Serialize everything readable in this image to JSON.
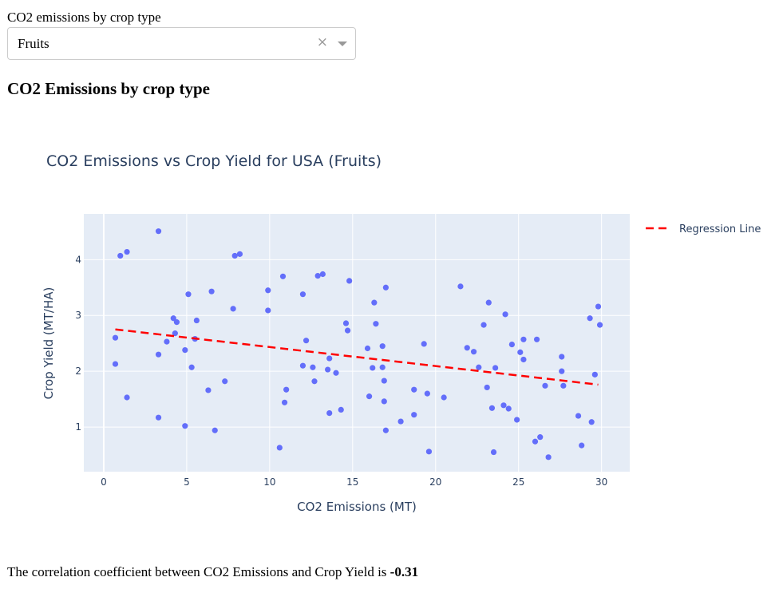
{
  "dropdown": {
    "label": "CO2 emissions by crop type",
    "selected": "Fruits",
    "clear_glyph": "×"
  },
  "heading": "CO2 Emissions by crop type",
  "correlation": {
    "text": "The correlation coefficient between CO2 Emissions and Crop Yield is ",
    "value": "-0.31"
  },
  "colors": {
    "marker": "#636efa",
    "regression": "#ff0000",
    "plot_bg": "#e5ecf6",
    "title": "#2a3f5f"
  },
  "chart_data": {
    "type": "scatter",
    "title": "CO2 Emissions vs Crop Yield for USA (Fruits)",
    "xlabel": "CO2 Emissions (MT)",
    "ylabel": "Crop Yield (MT/HA)",
    "xlim": [
      -1.2,
      31.7
    ],
    "ylim": [
      0.2,
      4.82
    ],
    "xticks": [
      0,
      5,
      10,
      15,
      20,
      25,
      30
    ],
    "yticks": [
      1,
      2,
      3,
      4
    ],
    "grid": true,
    "legend": {
      "position": "top-right",
      "entries": [
        "Regression Line"
      ]
    },
    "series": [
      {
        "name": "",
        "mode": "markers",
        "points": [
          [
            0.7,
            2.6
          ],
          [
            0.7,
            2.13
          ],
          [
            1.0,
            4.07
          ],
          [
            1.4,
            4.14
          ],
          [
            1.4,
            1.53
          ],
          [
            3.3,
            4.51
          ],
          [
            3.3,
            2.3
          ],
          [
            3.3,
            1.17
          ],
          [
            3.8,
            2.53
          ],
          [
            4.2,
            2.95
          ],
          [
            4.4,
            2.88
          ],
          [
            4.3,
            2.68
          ],
          [
            4.9,
            2.38
          ],
          [
            4.9,
            1.02
          ],
          [
            5.1,
            3.38
          ],
          [
            5.3,
            2.07
          ],
          [
            5.5,
            2.58
          ],
          [
            5.6,
            2.91
          ],
          [
            6.3,
            1.66
          ],
          [
            6.5,
            3.43
          ],
          [
            6.7,
            0.94
          ],
          [
            7.3,
            1.82
          ],
          [
            7.8,
            3.12
          ],
          [
            7.9,
            4.07
          ],
          [
            8.2,
            4.1
          ],
          [
            9.9,
            3.45
          ],
          [
            9.9,
            3.09
          ],
          [
            10.6,
            0.63
          ],
          [
            10.8,
            3.7
          ],
          [
            10.9,
            1.44
          ],
          [
            11.0,
            1.67
          ],
          [
            12.0,
            3.38
          ],
          [
            12.0,
            2.1
          ],
          [
            12.2,
            2.55
          ],
          [
            12.6,
            2.07
          ],
          [
            12.7,
            1.82
          ],
          [
            12.9,
            3.71
          ],
          [
            13.2,
            3.74
          ],
          [
            13.5,
            2.03
          ],
          [
            13.6,
            2.23
          ],
          [
            13.6,
            1.25
          ],
          [
            14.0,
            1.97
          ],
          [
            14.3,
            1.31
          ],
          [
            14.6,
            2.86
          ],
          [
            14.7,
            2.73
          ],
          [
            14.8,
            3.62
          ],
          [
            15.9,
            2.41
          ],
          [
            16.0,
            1.55
          ],
          [
            16.2,
            2.06
          ],
          [
            16.3,
            3.23
          ],
          [
            16.4,
            2.85
          ],
          [
            16.8,
            2.45
          ],
          [
            16.8,
            2.07
          ],
          [
            16.9,
            1.83
          ],
          [
            16.9,
            1.46
          ],
          [
            17.0,
            3.5
          ],
          [
            17.0,
            0.94
          ],
          [
            17.9,
            1.1
          ],
          [
            18.7,
            1.67
          ],
          [
            18.7,
            1.22
          ],
          [
            19.3,
            2.49
          ],
          [
            19.5,
            1.6
          ],
          [
            19.6,
            0.56
          ],
          [
            20.5,
            1.53
          ],
          [
            21.5,
            3.52
          ],
          [
            21.9,
            2.42
          ],
          [
            22.3,
            2.35
          ],
          [
            22.6,
            2.07
          ],
          [
            22.9,
            2.83
          ],
          [
            23.1,
            1.71
          ],
          [
            23.2,
            3.23
          ],
          [
            23.4,
            1.34
          ],
          [
            23.5,
            0.55
          ],
          [
            23.6,
            2.06
          ],
          [
            24.1,
            1.39
          ],
          [
            24.2,
            3.02
          ],
          [
            24.4,
            1.33
          ],
          [
            24.6,
            2.48
          ],
          [
            24.9,
            1.13
          ],
          [
            25.1,
            2.34
          ],
          [
            25.3,
            2.57
          ],
          [
            25.3,
            2.21
          ],
          [
            26.0,
            0.74
          ],
          [
            26.1,
            2.57
          ],
          [
            26.3,
            0.82
          ],
          [
            26.6,
            1.74
          ],
          [
            26.8,
            0.46
          ],
          [
            27.6,
            2.26
          ],
          [
            27.6,
            2.0
          ],
          [
            27.7,
            1.74
          ],
          [
            28.6,
            1.2
          ],
          [
            28.8,
            0.67
          ],
          [
            29.3,
            2.95
          ],
          [
            29.4,
            1.09
          ],
          [
            29.6,
            1.94
          ],
          [
            29.8,
            3.16
          ],
          [
            29.9,
            2.83
          ]
        ]
      },
      {
        "name": "Regression Line",
        "mode": "lines",
        "dash": "dash",
        "x": [
          0.7,
          29.8
        ],
        "y": [
          2.75,
          1.76
        ]
      }
    ]
  }
}
